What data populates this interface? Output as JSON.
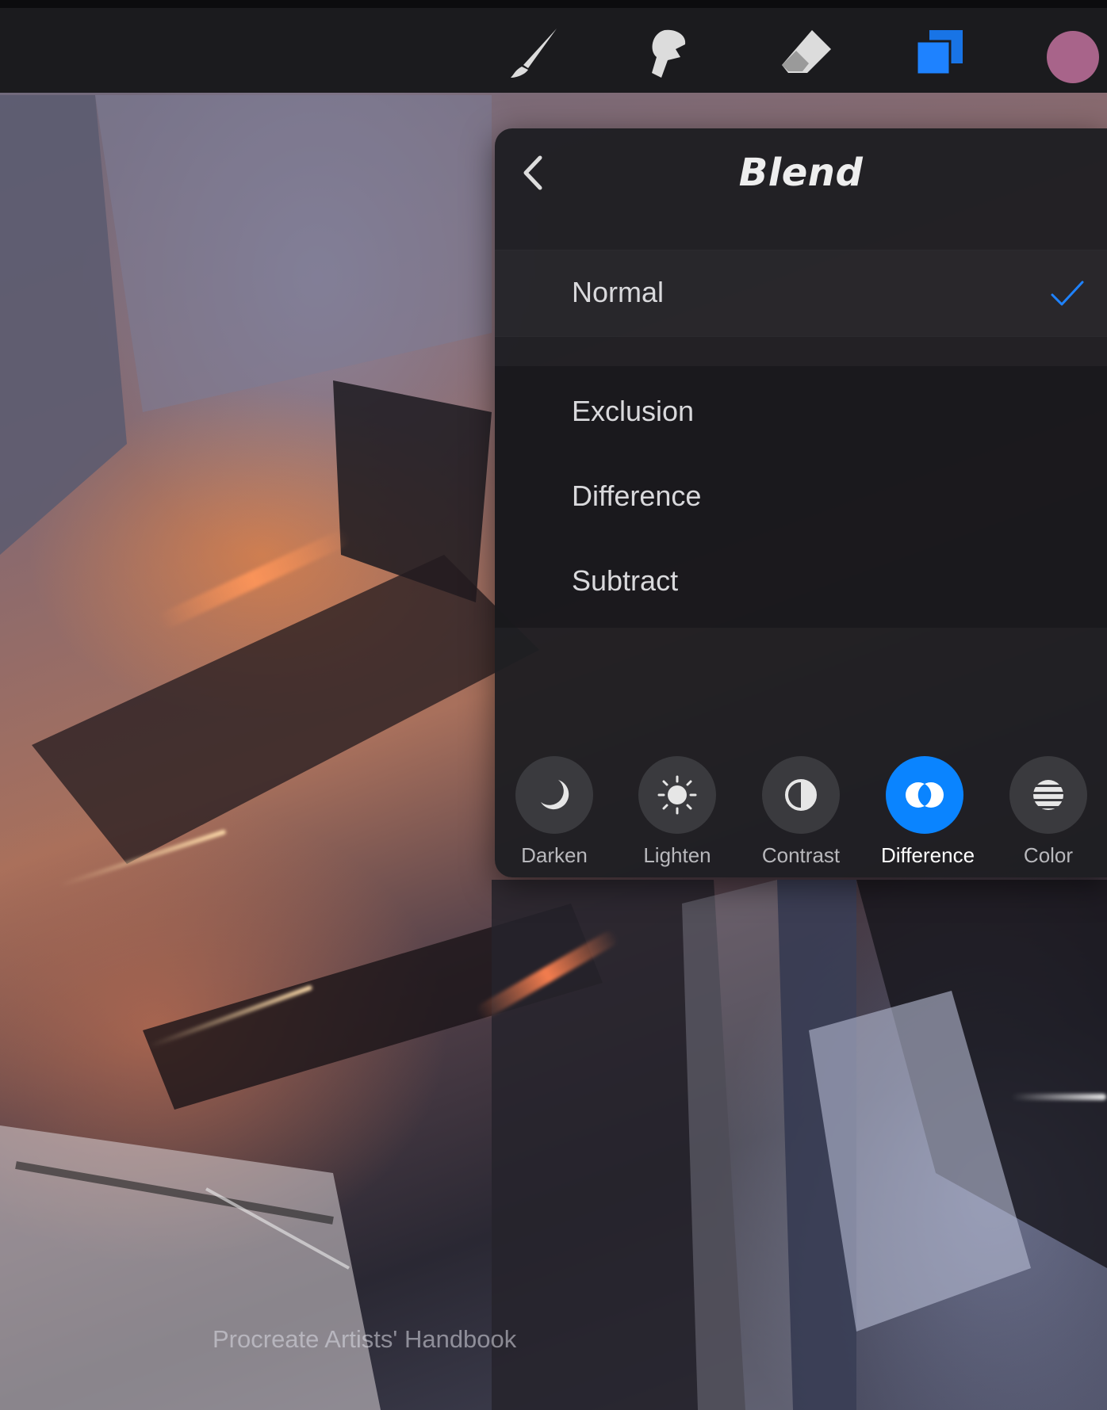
{
  "toolbar": {
    "tools": [
      {
        "name": "brush",
        "icon": "brush-icon"
      },
      {
        "name": "smudge",
        "icon": "smudge-icon"
      },
      {
        "name": "eraser",
        "icon": "eraser-icon"
      },
      {
        "name": "layers",
        "icon": "layers-icon",
        "active": true
      }
    ],
    "current_color": "#a8648a",
    "accent_color": "#0a84ff"
  },
  "blend_panel": {
    "title": "Blend",
    "back_icon": "chevron-left-icon",
    "selected_mode": {
      "label": "Normal",
      "checked_icon": "checkmark-icon"
    },
    "modes": [
      {
        "label": "Exclusion"
      },
      {
        "label": "Difference"
      },
      {
        "label": "Subtract"
      }
    ],
    "categories": [
      {
        "label": "Darken",
        "icon": "moon-icon",
        "active": false
      },
      {
        "label": "Lighten",
        "icon": "sun-icon",
        "active": false
      },
      {
        "label": "Contrast",
        "icon": "half-circle-icon",
        "active": false
      },
      {
        "label": "Difference",
        "icon": "difference-icon",
        "active": true
      },
      {
        "label": "Color",
        "icon": "striped-circle-icon",
        "active": false
      }
    ]
  },
  "watermark": "Procreate Artists' Handbook"
}
